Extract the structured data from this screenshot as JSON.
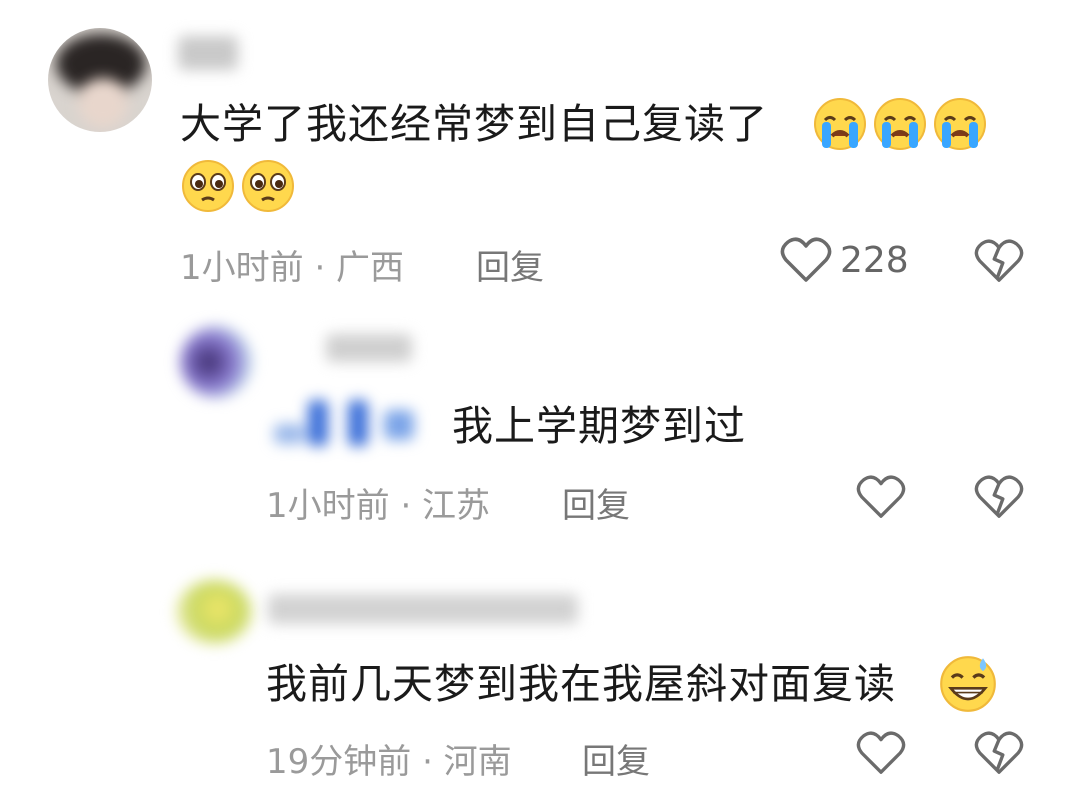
{
  "comments": [
    {
      "text": "大学了我还经常梦到自己复读了",
      "meta": "1小时前 · 广西",
      "reply_label": "回复",
      "like_count": "228"
    },
    {
      "text": "我上学期梦到过",
      "meta": "1小时前 · 江苏",
      "reply_label": "回复"
    },
    {
      "text": "我前几天梦到我在我屋斜对面复读",
      "meta": "19分钟前 · 河南",
      "reply_label": "回复"
    }
  ],
  "colors": {
    "text": "#1a1a1a",
    "meta": "#9a9a9a",
    "icon": "#6b6b6b",
    "emoji_face": "#ffd84d"
  },
  "icons": [
    "heart-outline-icon",
    "broken-heart-icon",
    "crying-face-emoji",
    "pleading-face-emoji",
    "grinning-sweat-emoji"
  ]
}
